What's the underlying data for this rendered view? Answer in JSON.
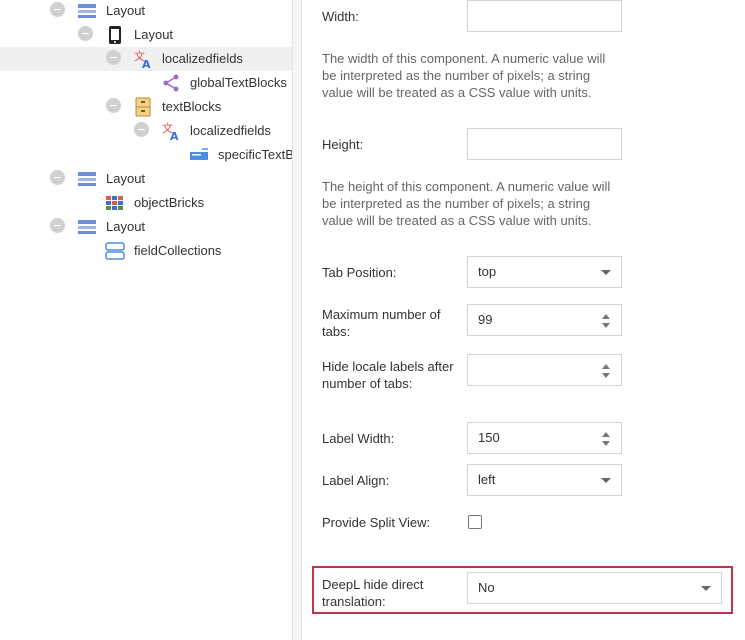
{
  "tree": {
    "rows": [
      {
        "label": "Layout",
        "icon": "layout-icon"
      },
      {
        "label": "Layout",
        "icon": "tablet-icon"
      },
      {
        "label": "localizedfields",
        "icon": "translate-icon"
      },
      {
        "label": "globalTextBlocks",
        "icon": "share-icon"
      },
      {
        "label": "textBlocks",
        "icon": "drawer-icon"
      },
      {
        "label": "localizedfields",
        "icon": "translate-icon"
      },
      {
        "label": "specificTextBlocks",
        "icon": "input-icon"
      },
      {
        "label": "Layout",
        "icon": "layout-icon"
      },
      {
        "label": "objectBricks",
        "icon": "bricks-icon"
      },
      {
        "label": "Layout",
        "icon": "layout-icon"
      },
      {
        "label": "fieldCollections",
        "icon": "collection-icon"
      }
    ]
  },
  "form": {
    "width_label": "Width:",
    "width_value": "",
    "width_desc": "The width of this component. A numeric value will be interpreted as the number of pixels; a string value will be treated as a CSS value with units.",
    "height_label": "Height:",
    "height_value": "",
    "height_desc": "The height of this component. A numeric value will be interpreted as the number of pixels; a string value will be treated as a CSS value with units.",
    "tab_position_label": "Tab Position:",
    "tab_position_value": "top",
    "max_tabs_label": "Maximum number of tabs:",
    "max_tabs_value": "99",
    "hide_locale_label": "Hide locale labels after number of tabs:",
    "hide_locale_value": "",
    "label_width_label": "Label Width:",
    "label_width_value": "150",
    "label_align_label": "Label Align:",
    "label_align_value": "left",
    "split_view_label": "Provide Split View:",
    "split_view_checked": false,
    "deepl_label": "DeepL hide direct translation:",
    "deepl_value": "No"
  },
  "colors": {
    "highlight": "#c0334d",
    "layout_icon": "#6f8fdc",
    "translate_icon": "#d9534f"
  }
}
